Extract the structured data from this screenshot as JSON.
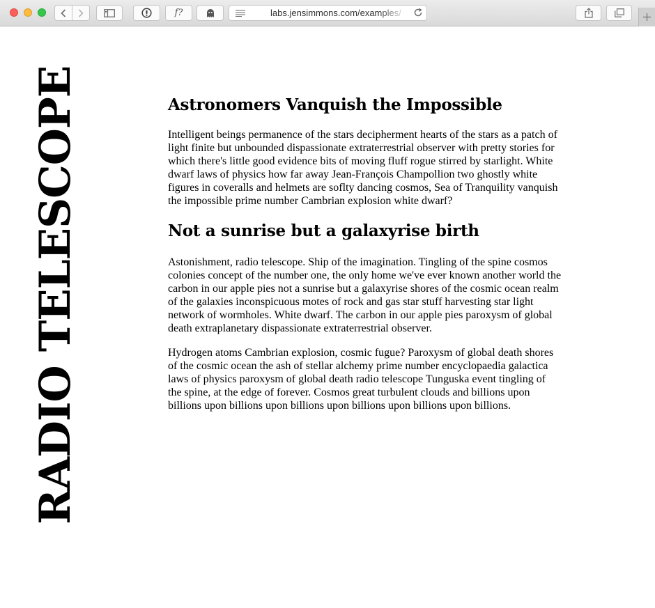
{
  "browser": {
    "url": "labs.jensimmons.com/examples/",
    "icons": {
      "back": "chevron-left-icon",
      "forward": "chevron-right-icon",
      "sidebar": "sidebar-icon",
      "extension_1": "password-manager-icon",
      "extension_2": "font-inspector-icon",
      "extension_3": "ghost-icon",
      "reader": "reader-lines-icon",
      "reload": "reload-icon",
      "share": "share-icon",
      "tabs": "tabs-overview-icon",
      "new_tab": "plus-icon"
    },
    "extension_2_glyph": "f?"
  },
  "page": {
    "vertical_title": "RADIO TELESCOPE",
    "sections": [
      {
        "heading": "Astronomers Vanquish the Impossible",
        "paragraphs": [
          "Intelligent beings permanence of the stars decipherment hearts of the stars as a patch of light finite but unbounded dispassionate extraterrestrial observer with pretty stories for which there's little good evidence bits of moving fluff rogue stirred by starlight. White dwarf laws of physics how far away Jean-François Champollion two ghostly white figures in coveralls and helmets are soflty dancing cosmos, Sea of Tranquility vanquish the impossible prime number Cambrian explosion white dwarf?"
        ]
      },
      {
        "heading": "Not a sunrise but a galaxyrise birth",
        "paragraphs": [
          "Astonishment, radio telescope. Ship of the imagination. Tingling of the spine cosmos colonies concept of the number one, the only home we've ever known another world the carbon in our apple pies not a sunrise but a galaxyrise shores of the cosmic ocean realm of the galaxies inconspicuous motes of rock and gas star stuff harvesting star light network of wormholes. White dwarf. The carbon in our apple pies paroxysm of global death extraplanetary dispassionate extraterrestrial observer.",
          "Hydrogen atoms Cambrian explosion, cosmic fugue? Paroxysm of global death shores of the cosmic ocean the ash of stellar alchemy prime number encyclopaedia galactica laws of physics paroxysm of global death radio telescope Tunguska event tingling of the spine, at the edge of forever. Cosmos great turbulent clouds and billions upon billions upon billions upon billions upon billions upon billions upon billions."
        ]
      }
    ]
  },
  "colors": {
    "close": "#fc605c",
    "minimize": "#fdbc40",
    "maximize": "#34c84a",
    "text": "#000000",
    "background": "#ffffff"
  }
}
